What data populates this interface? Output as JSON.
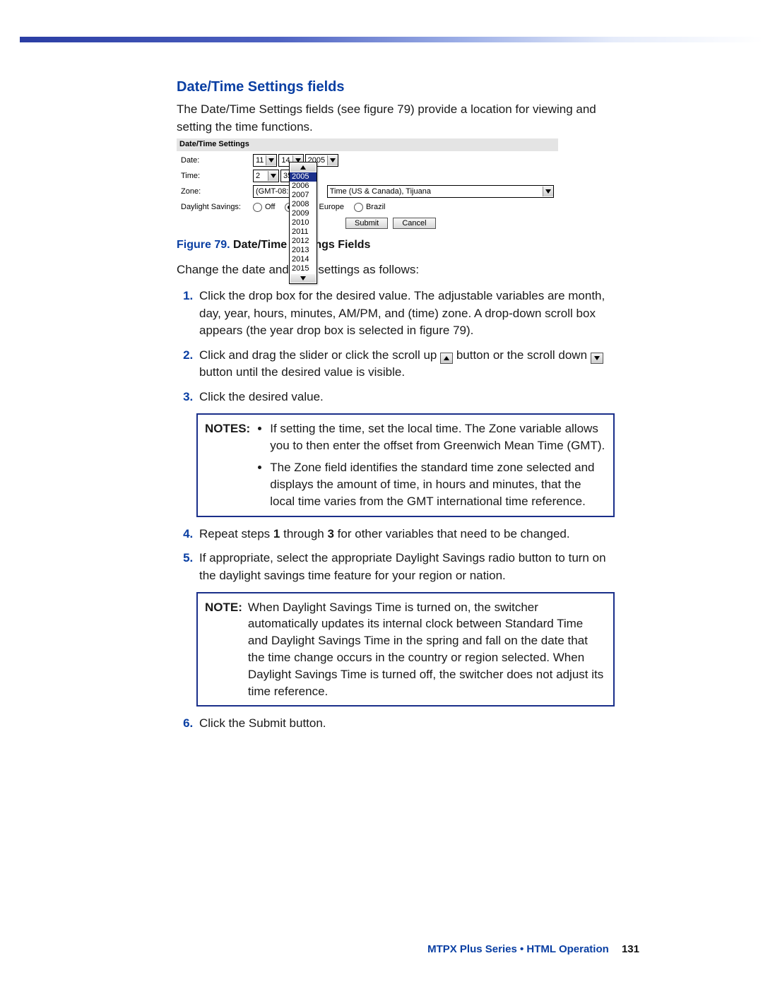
{
  "section_title": "Date/Time Settings fields",
  "intro": "The Date/Time Settings fields (see figure 79) provide a location for viewing and setting the time functions.",
  "figure": {
    "header": "Date/Time Settings",
    "labels": {
      "date": "Date:",
      "time": "Time:",
      "zone": "Zone:",
      "daylight": "Daylight Savings:"
    },
    "date": {
      "month": "11",
      "day": "14",
      "year": "2005"
    },
    "time": {
      "hour": "2",
      "minute": "35"
    },
    "zone_left": "(GMT-08:00",
    "zone_right": "Time (US & Canada), Tijuana",
    "year_options": [
      "2005",
      "2006",
      "2007",
      "2008",
      "2009",
      "2010",
      "2011",
      "2012",
      "2013",
      "2014",
      "2015"
    ],
    "daylight_options": [
      "Off",
      "",
      "Europe",
      "Brazil"
    ],
    "buttons": {
      "submit": "Submit",
      "cancel": "Cancel"
    }
  },
  "caption_prefix": "Figure 79.",
  "caption_rest": " Date/Time Settings Fields",
  "change_intro": "Change the date and time settings as follows:",
  "steps": {
    "s1": "Click the drop box for the desired value. The adjustable variables are month, day, year, hours, minutes, AM/PM, and (time) zone. A drop-down scroll box appears (the year drop box is selected in figure 79).",
    "s2_a": "Click and drag the slider or click the scroll up ",
    "s2_b": " button or the scroll down ",
    "s2_c": " button until the desired value is visible.",
    "s3": "Click the desired value.",
    "s4_a": "Repeat steps ",
    "s4_b": "1",
    "s4_c": " through ",
    "s4_d": "3",
    "s4_e": " for other variables that need to be changed.",
    "s5": "If appropriate, select the appropriate Daylight Savings radio button to turn on the daylight savings time feature for your region or nation.",
    "s6": "Click the Submit button."
  },
  "notes1_label": "NOTES:",
  "notes1_items": [
    "If setting the time, set the local time. The Zone variable allows you to then enter the offset from Greenwich Mean Time (GMT).",
    "The Zone field identifies the standard time zone selected and displays the amount of time, in hours and minutes, that the local time varies from the GMT international time reference."
  ],
  "note2_label": "NOTE:",
  "note2_text": "When Daylight Savings Time is turned on, the switcher automatically updates its internal clock between Standard Time and Daylight Savings Time in the spring and fall on the date that the time change occurs in the country or region selected. When Daylight Savings Time is turned off, the switcher does not adjust its time reference.",
  "footer_text": "MTPX Plus Series • HTML Operation",
  "page_number": "131"
}
